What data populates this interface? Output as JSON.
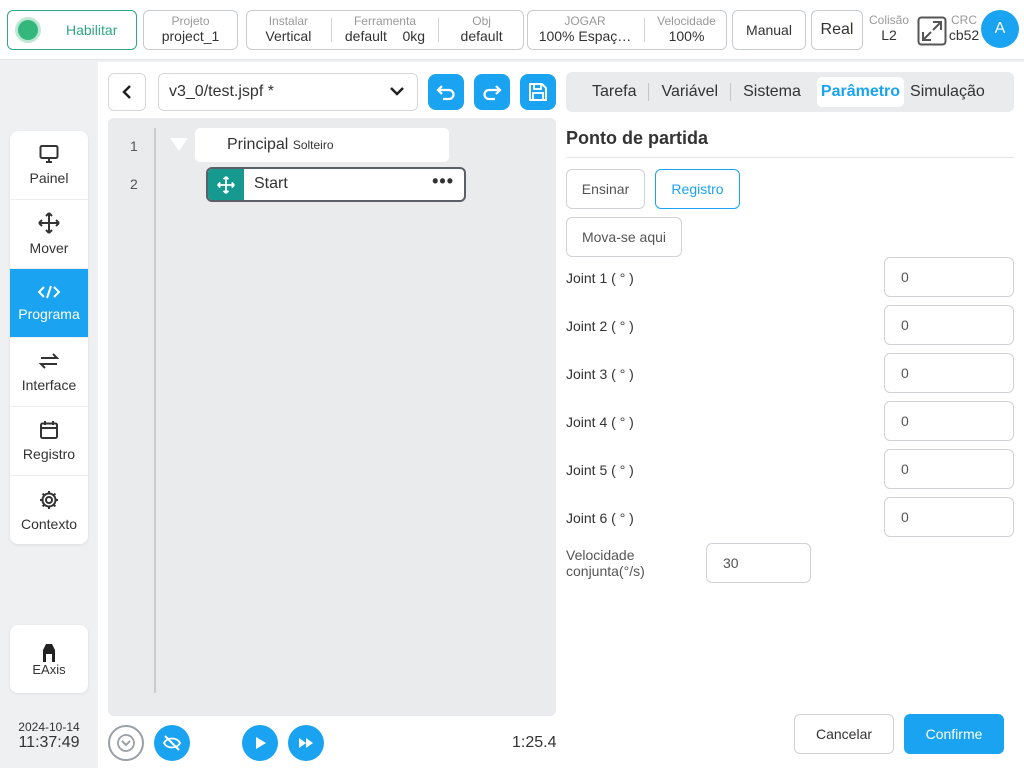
{
  "topbar": {
    "enable_label": "Habilitar",
    "project": {
      "title": "Projeto",
      "value": "project_1"
    },
    "install": {
      "title": "Instalar",
      "value": "Vertical"
    },
    "tool": {
      "title": "Ferramenta",
      "value": "default",
      "weight": "0kg"
    },
    "obj": {
      "title": "Obj",
      "value": "default"
    },
    "jog": {
      "title": "JOGAR",
      "value": "100%  Espaç…"
    },
    "speed": {
      "title": "Velocidade",
      "value": "100%"
    },
    "mode_label": "Manual",
    "real_label": "Real",
    "collision": {
      "title": "Colisão",
      "value": "L2"
    },
    "crc": {
      "title": "CRC",
      "value": "cb52"
    },
    "avatar": "A"
  },
  "sidebar": {
    "items": [
      {
        "label": "Painel",
        "icon": "monitor-icon"
      },
      {
        "label": "Mover",
        "icon": "move-icon"
      },
      {
        "label": "Programa",
        "icon": "code-icon"
      },
      {
        "label": "Interface",
        "icon": "swap-icon"
      },
      {
        "label": "Registro",
        "icon": "calendar-icon"
      },
      {
        "label": "Contexto",
        "icon": "gear-icon"
      }
    ],
    "eaxis_label": "EAxis",
    "date": "2024-10-14",
    "time": "11:37:49"
  },
  "editor": {
    "file_name": "v3_0/test.jspf *",
    "line_numbers": [
      "1",
      "2"
    ],
    "main_node": "Principal",
    "main_node_sub": "Solteiro",
    "start_node": "Start",
    "start_more": "•••",
    "runtime": "1:25.4"
  },
  "tabs": [
    "Tarefa",
    "Variável",
    "Sistema",
    "Parâmetro",
    "Simulação"
  ],
  "active_tab": "Parâmetro",
  "panel": {
    "title": "Ponto de partida",
    "teach_label": "Ensinar",
    "record_label": "Registro",
    "move_here_label": "Mova-se aqui",
    "joints": [
      {
        "label": "Joint 1 ( ° )",
        "value": "0"
      },
      {
        "label": "Joint 2 ( ° )",
        "value": "0"
      },
      {
        "label": "Joint 3 ( ° )",
        "value": "0"
      },
      {
        "label": "Joint 4 ( ° )",
        "value": "0"
      },
      {
        "label": "Joint 5 ( ° )",
        "value": "0"
      },
      {
        "label": "Joint 6 ( ° )",
        "value": "0"
      }
    ],
    "velocity_label_1": "Velocidade",
    "velocity_label_2": "conjunta(°/s)",
    "velocity_value": "30",
    "cancel_label": "Cancelar",
    "confirm_label": "Confirme"
  },
  "colors": {
    "accent": "#1aa3f0",
    "enable": "#33b77d",
    "move_node": "#16998e"
  }
}
